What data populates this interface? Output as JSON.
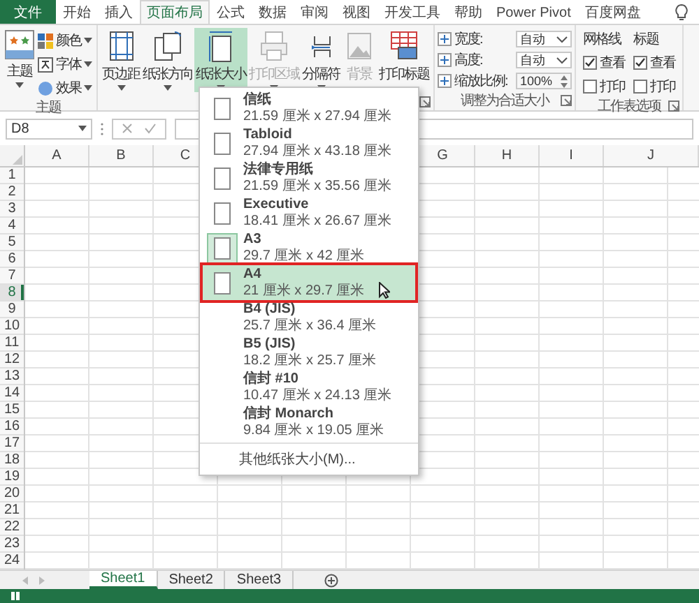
{
  "menu_tabs": [
    {
      "label": "文件",
      "kind": "file",
      "selected": false
    },
    {
      "label": "开始",
      "kind": "tab",
      "selected": false
    },
    {
      "label": "插入",
      "kind": "tab",
      "selected": false
    },
    {
      "label": "页面布局",
      "kind": "tab",
      "selected": true
    },
    {
      "label": "公式",
      "kind": "tab",
      "selected": false
    },
    {
      "label": "数据",
      "kind": "tab",
      "selected": false
    },
    {
      "label": "审阅",
      "kind": "tab",
      "selected": false
    },
    {
      "label": "视图",
      "kind": "tab",
      "selected": false
    },
    {
      "label": "开发工具",
      "kind": "tab",
      "selected": false
    },
    {
      "label": "帮助",
      "kind": "tab",
      "selected": false
    },
    {
      "label": "Power Pivot",
      "kind": "tab",
      "selected": false
    },
    {
      "label": "百度网盘",
      "kind": "tab",
      "selected": false
    }
  ],
  "ribbon": {
    "groups": [
      {
        "kind": "theme",
        "label": "主题",
        "big_button": {
          "label": "主题"
        },
        "items": [
          {
            "label": "颜色"
          },
          {
            "label": "字体"
          },
          {
            "label": "效果"
          }
        ]
      },
      {
        "kind": "buttons",
        "launcher": true,
        "buttons": [
          {
            "label": "页边距",
            "menu": true,
            "selected": false,
            "disabled": false
          },
          {
            "label": "纸张方向",
            "menu": true,
            "selected": false,
            "disabled": false
          },
          {
            "label": "纸张大小",
            "menu": true,
            "selected": true,
            "disabled": false
          },
          {
            "label": "打印区域",
            "menu": true,
            "selected": false,
            "disabled": true
          },
          {
            "label": "分隔符",
            "menu": true,
            "selected": false,
            "disabled": false
          },
          {
            "label": "背景",
            "menu": false,
            "selected": false,
            "disabled": true
          },
          {
            "label": "打印标题",
            "menu": false,
            "selected": false,
            "disabled": false
          }
        ]
      },
      {
        "kind": "scale",
        "label": "调整为合适大小",
        "launcher": true,
        "fields": [
          {
            "label": "宽度:",
            "value": "自动",
            "kind": "dropdown"
          },
          {
            "label": "高度:",
            "value": "自动",
            "kind": "dropdown"
          },
          {
            "label": "缩放比例:",
            "value": "100%",
            "kind": "spinner"
          }
        ]
      },
      {
        "kind": "options",
        "label": "工作表选项",
        "launcher": true,
        "columns": [
          {
            "heading": "网格线",
            "items": [
              {
                "label": "查看",
                "checked": true
              },
              {
                "label": "打印",
                "checked": false
              }
            ]
          },
          {
            "heading": "标题",
            "items": [
              {
                "label": "查看",
                "checked": true
              },
              {
                "label": "打印",
                "checked": false
              }
            ]
          }
        ]
      }
    ]
  },
  "name_box": {
    "value": "D8"
  },
  "sheet": {
    "columns_left": [
      "A",
      "B",
      "C"
    ],
    "columns_right": [
      "G",
      "H",
      "I",
      "J"
    ],
    "rows": [
      {
        "label": "1",
        "selected": false
      },
      {
        "label": "2",
        "selected": false
      },
      {
        "label": "3",
        "selected": false
      },
      {
        "label": "4",
        "selected": false
      },
      {
        "label": "5",
        "selected": false
      },
      {
        "label": "6",
        "selected": false
      },
      {
        "label": "7",
        "selected": false
      },
      {
        "label": "8",
        "selected": true
      },
      {
        "label": "9",
        "selected": false
      },
      {
        "label": "10",
        "selected": false
      },
      {
        "label": "11",
        "selected": false
      },
      {
        "label": "12",
        "selected": false
      },
      {
        "label": "13",
        "selected": false
      },
      {
        "label": "14",
        "selected": false
      },
      {
        "label": "15",
        "selected": false
      },
      {
        "label": "16",
        "selected": false
      },
      {
        "label": "17",
        "selected": false
      },
      {
        "label": "18",
        "selected": false
      },
      {
        "label": "19",
        "selected": false
      },
      {
        "label": "20",
        "selected": false
      },
      {
        "label": "21",
        "selected": false
      },
      {
        "label": "22",
        "selected": false
      },
      {
        "label": "23",
        "selected": false
      },
      {
        "label": "24",
        "selected": false
      }
    ]
  },
  "paper_menu": {
    "items": [
      {
        "name": "信纸",
        "size": "21.59 厘米 x 27.94 厘米",
        "kind": "icon",
        "current": false,
        "selected": false
      },
      {
        "name": "Tabloid",
        "size": "27.94 厘米 x 43.18 厘米",
        "kind": "icon",
        "current": false,
        "selected": false
      },
      {
        "name": "法律专用纸",
        "size": "21.59 厘米 x 35.56 厘米",
        "kind": "icon",
        "current": false,
        "selected": false
      },
      {
        "name": "Executive",
        "size": "18.41 厘米 x 26.67 厘米",
        "kind": "icon",
        "current": false,
        "selected": false
      },
      {
        "name": "A3",
        "size": "29.7 厘米 x 42 厘米",
        "kind": "icon",
        "current": true,
        "selected": false
      },
      {
        "name": "A4",
        "size": "21 厘米 x 29.7 厘米",
        "kind": "icon",
        "current": false,
        "selected": true
      },
      {
        "name": "B4 (JIS)",
        "size": "25.7 厘米 x 36.4 厘米",
        "kind": "plain",
        "selected": false
      },
      {
        "name": "B5 (JIS)",
        "size": "18.2 厘米 x 25.7 厘米",
        "kind": "plain",
        "selected": false
      },
      {
        "name": "信封 #10",
        "size": "10.47 厘米 x 24.13 厘米",
        "kind": "plain",
        "selected": false
      },
      {
        "name": "信封 Monarch",
        "size": "9.84 厘米 x 19.05 厘米",
        "kind": "plain",
        "selected": false
      }
    ],
    "more": "其他纸张大小(M)..."
  },
  "sheet_tabs": [
    {
      "label": "Sheet1",
      "selected": true
    },
    {
      "label": "Sheet2",
      "selected": false
    },
    {
      "label": "Sheet3",
      "selected": false
    }
  ]
}
